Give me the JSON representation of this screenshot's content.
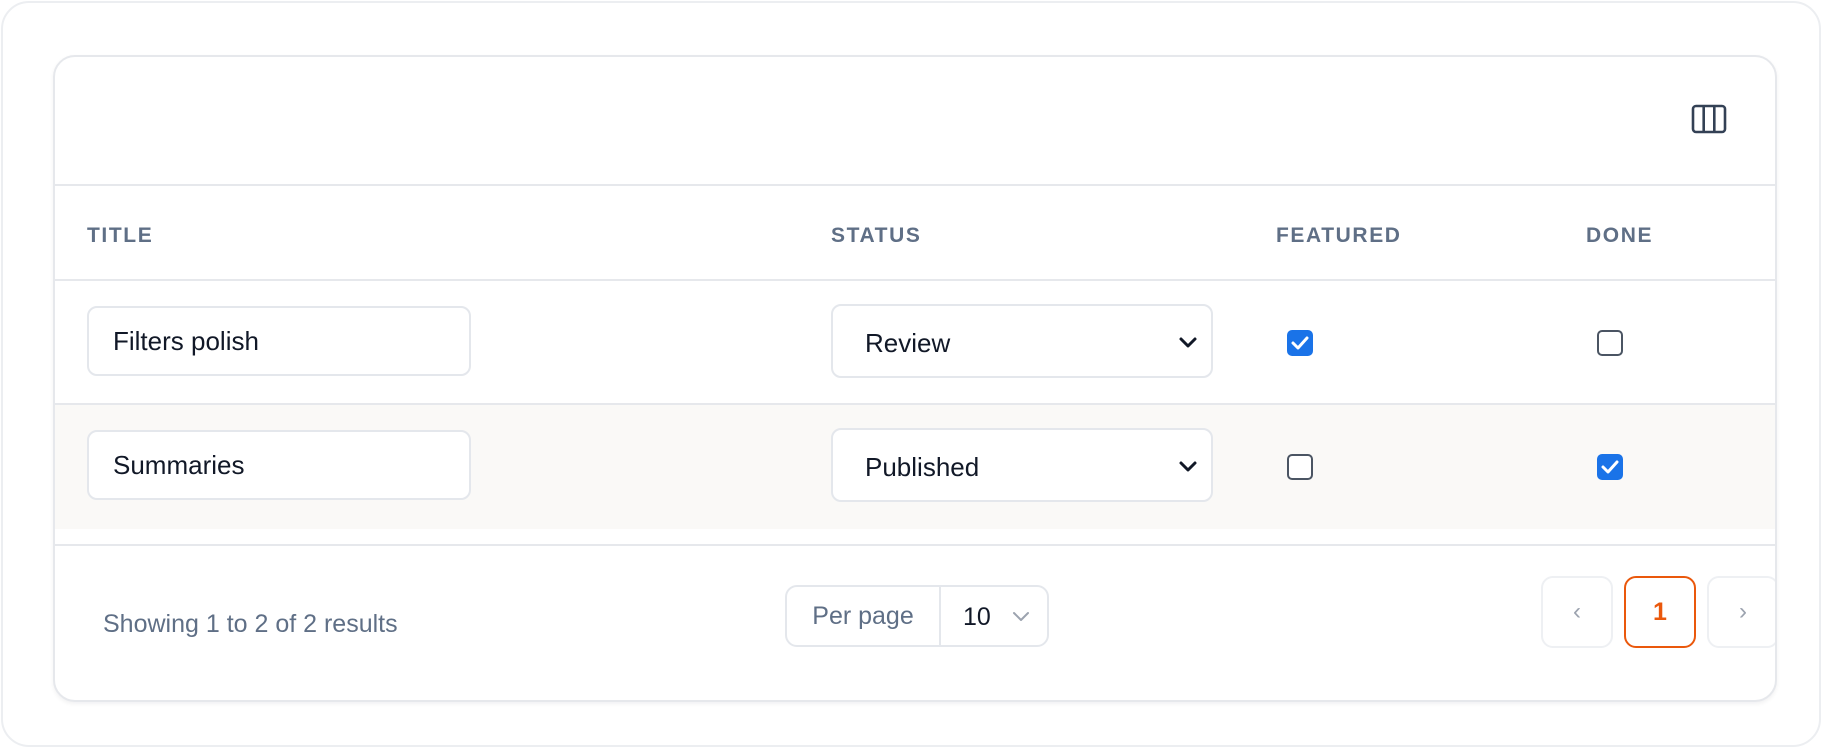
{
  "table": {
    "columns": {
      "title": "TITLE",
      "status": "STATUS",
      "featured": "FEATURED",
      "done": "DONE"
    },
    "rows": [
      {
        "title": "Filters polish",
        "status": "Review",
        "featured": true,
        "done": false
      },
      {
        "title": "Summaries",
        "status": "Published",
        "featured": false,
        "done": true
      }
    ]
  },
  "toolbar": {
    "column_toggle_icon": "columns-icon"
  },
  "footer": {
    "results_text": "Showing 1 to 2 of 2 results",
    "per_page_label": "Per page",
    "per_page_value": "10",
    "pagination": {
      "prev_label": "‹",
      "current_page": "1",
      "next_label": "›"
    }
  },
  "colors": {
    "accent": "#ea580c",
    "checkbox_checked": "#1a73e8",
    "header_text": "#5f6f86",
    "border": "#e6e8ec",
    "alt_row": "#faf9f7"
  },
  "icons": {
    "chevron": "chevron-down-icon",
    "check": "check-icon"
  }
}
